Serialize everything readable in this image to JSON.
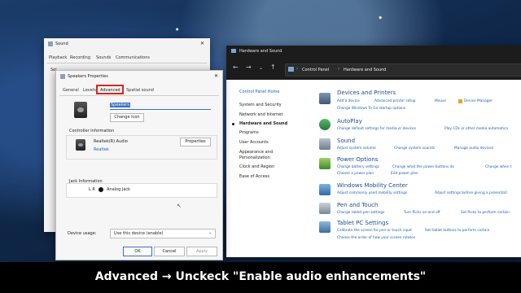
{
  "hardware_window": {
    "title": "Hardware and Sound",
    "breadcrumb": [
      "Control Panel",
      "Hardware and Sound"
    ],
    "sidebar": [
      "Control Panel Home",
      "System and Security",
      "Network and Internet",
      "Hardware and Sound",
      "Programs",
      "User Accounts",
      "Appearance and Personalization",
      "Clock and Region",
      "Ease of Access"
    ],
    "sections": [
      {
        "title": "Devices and Printers",
        "links": [
          "Add a device",
          "Advanced printer setup",
          "Mouse",
          "Device Manager",
          "Change Windows To Go startup options"
        ],
        "icon": "printer-icon"
      },
      {
        "title": "AutoPlay",
        "links": [
          "Change default settings for media or devices",
          "Play CDs or other media automatica"
        ],
        "icon": "autoplay-icon"
      },
      {
        "title": "Sound",
        "links": [
          "Adjust system volume",
          "Change system sounds",
          "Manage audio devices"
        ],
        "icon": "speaker-icon"
      },
      {
        "title": "Power Options",
        "links": [
          "Change battery settings",
          "Change what the power buttons do",
          "Change when t",
          "Choose a power plan",
          "Edit power plan"
        ],
        "icon": "power-icon"
      },
      {
        "title": "Windows Mobility Center",
        "links": [
          "Adjust commonly used mobility settings",
          "Adjust settings before giving a presentati"
        ],
        "icon": "mobility-icon"
      },
      {
        "title": "Pen and Touch",
        "links": [
          "Change tablet pen settings",
          "Turn flicks on and off",
          "Set flicks to perform certain"
        ],
        "icon": "pen-icon"
      },
      {
        "title": "Tablet PC Settings",
        "links": [
          "Calibrate the screen for pen or touch input",
          "Set tablet buttons to perform certain",
          "Choose the order of how your screen rotates"
        ],
        "icon": "tablet-icon"
      }
    ]
  },
  "sound_dialog": {
    "title": "Sound",
    "tabs": [
      "Playback",
      "Recording",
      "Sounds",
      "Communications"
    ],
    "text": "Sel"
  },
  "speakers_dialog": {
    "title": "Speakers Properties",
    "tabs": [
      "General",
      "Levels",
      "Advanced",
      "Spatial sound"
    ],
    "name_value": "Speakers",
    "change_icon": "Change Icon",
    "controller_label": "Controller Information",
    "controller_name": "Realtek(R) Audio",
    "controller_vendor": "Realtek",
    "properties_button": "Properties",
    "jack_label": "Jack Information",
    "jack_lr": "L R",
    "jack_type": "Analog Jack",
    "device_usage_label": "Device usage:",
    "device_usage_value": "Use this device (enable)",
    "ok": "OK",
    "cancel": "Cancel",
    "apply": "Apply"
  },
  "caption": "Advanced → Unckeck \"Enable audio enhancements\"",
  "colors": {
    "highlight": "#d9261c",
    "link": "#1a5fb4",
    "section_title": "#1e4d8c"
  }
}
